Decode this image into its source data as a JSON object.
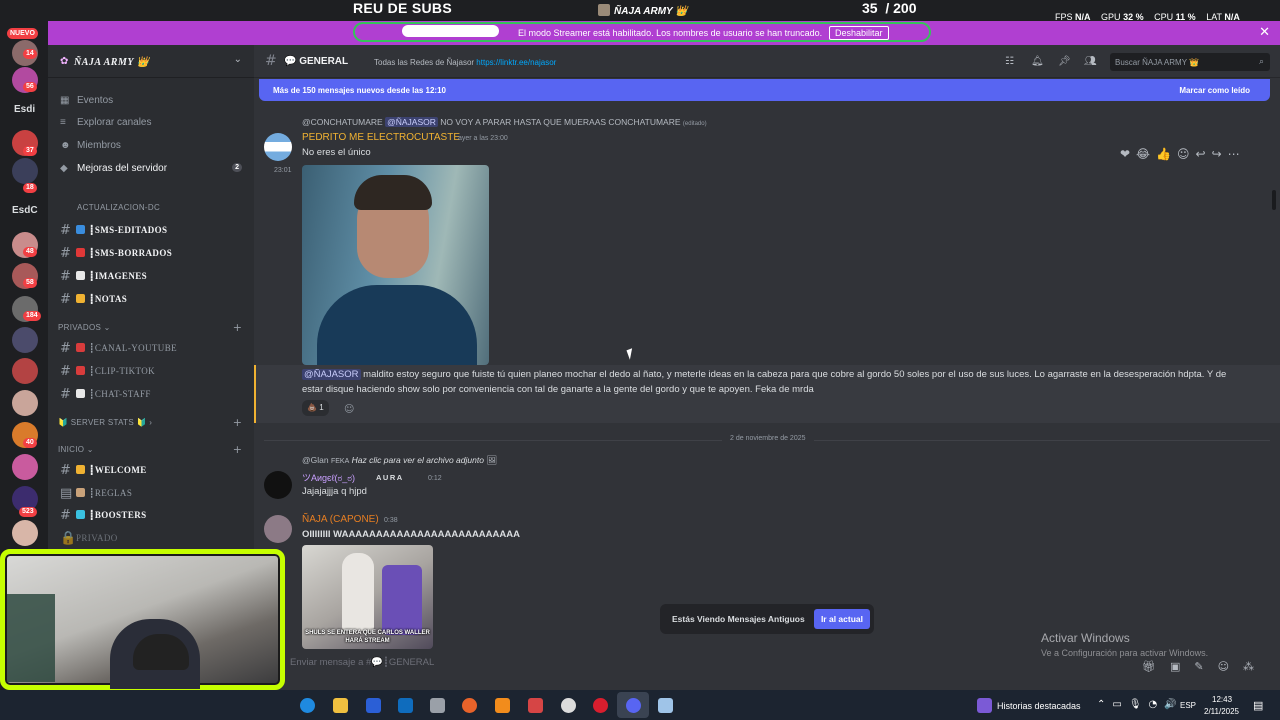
{
  "stream": {
    "title": "REU DE SUBS",
    "server_name": "ÑAJA ARMY 👑",
    "sub_count": "35",
    "sub_goal": "/ 200",
    "fps_label": "FPS",
    "fps_value": "N/A",
    "gpu_label": "GPU",
    "gpu_value": "32 %",
    "cpu_label": "CPU",
    "cpu_value": "11 %",
    "lat_label": "LAT",
    "lat_value": "N/A"
  },
  "notice": {
    "text": "El modo Streamer está habilitado. Los nombres de usuario se han truncado.",
    "button": "Deshabilitar"
  },
  "rail": {
    "nuevo": "NUEVO",
    "labels": [
      "Esdi",
      "EsdC"
    ],
    "badges": [
      "14",
      "56",
      "37",
      "18",
      "48",
      "58",
      "184",
      "40",
      "523",
      "353"
    ]
  },
  "sidebar": {
    "server_name": "ÑAJA ARMY 👑",
    "nav": [
      "Eventos",
      "Explorar canales",
      "Miembros",
      "Mejoras del servidor"
    ],
    "nav_badge": "2",
    "categories": {
      "actualizacion": "ACTUALIZACION-DC",
      "privados": "PRIVADOS",
      "server_stats": "🔰 SERVER STATS 🔰",
      "inicio": "INICIO"
    },
    "channels": {
      "sms_editados": "┋SMS-EDITADOS",
      "sms_borrados": "┋SMS-BORRADOS",
      "imagenes": "┋IMAGENES",
      "notas": "┋NOTAS",
      "canal_youtube": "┋CANAL-YOUTUBE",
      "clip_tiktok": "┋CLIP-TIKTOK",
      "chat_staff": "┋CHAT-STAFF",
      "welcome": "┋WELCOME",
      "reglas": "┋REGLAS",
      "boosters": "┋BOOSTERS",
      "privado": "PRIVADO"
    }
  },
  "channel": {
    "name": "GENERAL",
    "topic": "Todas las Redes de Ñajasor",
    "link": "https://linktr.ee/najasor",
    "search_placeholder": "Buscar ÑAJA ARMY 👑"
  },
  "new_messages": {
    "text": "Más de 150 mensajes nuevos desde las 12:10",
    "mark_read": "Marcar como leído"
  },
  "messages": {
    "m1": {
      "reply_user": "@CONCHATUMARE",
      "reply_mention": "@ÑAJASOR",
      "reply_text": "NO VOY A PARAR HASTA QUE MUERAAS CONCHATUMARE",
      "reply_edited": "(editado)",
      "author": "PEDRITO ME ELECTROCUTASTE",
      "time": "ayer a las 23:00",
      "text": "No eres el único",
      "side_time": "23:01",
      "mention": "@ÑAJASOR",
      "body": "maldito estoy seguro que fuiste tú quien planeo mochar el dedo al ñato, y meterle ideas en la cabeza para que cobre al gordo 50 soles por el uso de sus luces. Lo agarraste en la desesperación hdpta. Y de estar disque haciendo show solo por conveniencia con tal de ganarte a la gente del gordo y que te apoyen. Feka de mrda",
      "reaction_count": "1"
    },
    "date_divider": "2 de noviembre de 2025",
    "m2": {
      "reply_user": "@Glan",
      "reply_tag": "FEKA",
      "reply_text": "Haz clic para ver el archivo adjunto",
      "author": "ツAиgєℓ(ಠ_ಠ)",
      "tag": "AURA",
      "time": "0:12",
      "text": "Jajajajjja q hjpd"
    },
    "m3": {
      "author": "ÑAJA (CAPONE)",
      "time": "0:38",
      "text": "OIIIIIIII WAAAAAAAAAAAAAAAAAAAAAAAAAA",
      "image_caption": "SHULS SE ENTERA QUE CARLOS WALLER HARÁ STREAM"
    }
  },
  "old_messages": {
    "text": "Estás Viendo Mensajes Antiguos",
    "button": "Ir al actual"
  },
  "composer": {
    "placeholder": "Enviar mensaje a #💬┋GENERAL"
  },
  "watermark": {
    "line1": "Activar Windows",
    "line2": "Ve a Configuración para activar Windows."
  },
  "taskbar": {
    "news": "Historias destacadas",
    "lang": "ESP",
    "time": "12:43",
    "date": "2/11/2025"
  },
  "colors": {
    "accent": "#5865f2",
    "notice": "#b03fd1",
    "cam_border": "#c6ff00",
    "author_pedrito": "#f0b232",
    "author_capone": "#e67e22"
  }
}
